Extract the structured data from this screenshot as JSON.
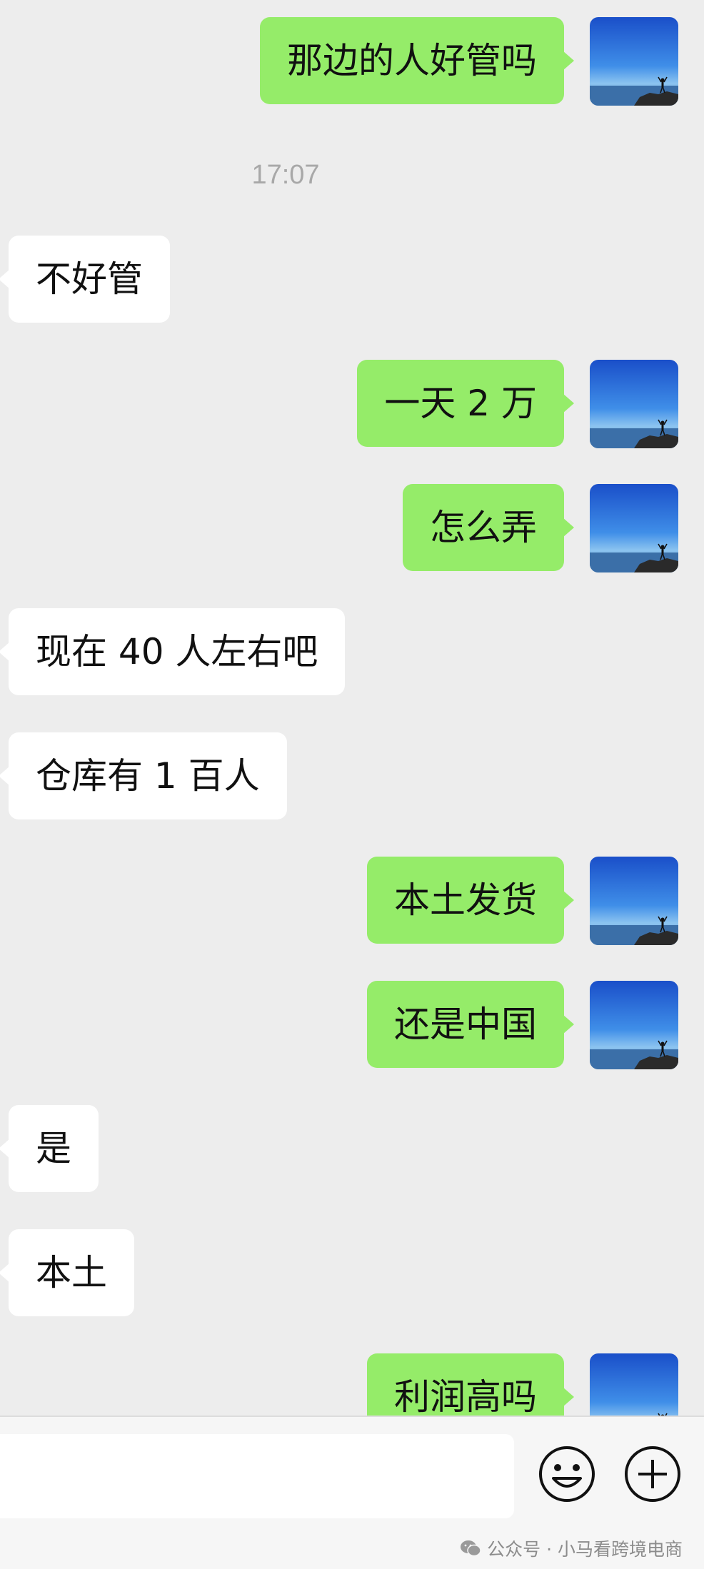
{
  "chat": {
    "timestamp": "17:07",
    "messages": [
      {
        "side": "out",
        "text": "那边的人好管吗"
      },
      {
        "side": "in",
        "text": "不好管"
      },
      {
        "side": "out",
        "text": "一天 2 万"
      },
      {
        "side": "out",
        "text": "怎么弄"
      },
      {
        "side": "in",
        "text": "现在 40 人左右吧"
      },
      {
        "side": "in",
        "text": "仓库有 1 百人"
      },
      {
        "side": "out",
        "text": "本土发货"
      },
      {
        "side": "out",
        "text": "还是中国"
      },
      {
        "side": "in",
        "text": "是"
      },
      {
        "side": "in",
        "text": "本土"
      },
      {
        "side": "out",
        "text": "利润高吗"
      }
    ]
  },
  "input_bar": {
    "emoji_icon": "emoji-icon",
    "plus_icon": "plus-icon"
  },
  "watermark": {
    "text": "公众号 · 小马看跨境电商"
  },
  "colors": {
    "background": "#ededed",
    "outgoing_bubble": "#95ec69",
    "incoming_bubble": "#ffffff"
  }
}
